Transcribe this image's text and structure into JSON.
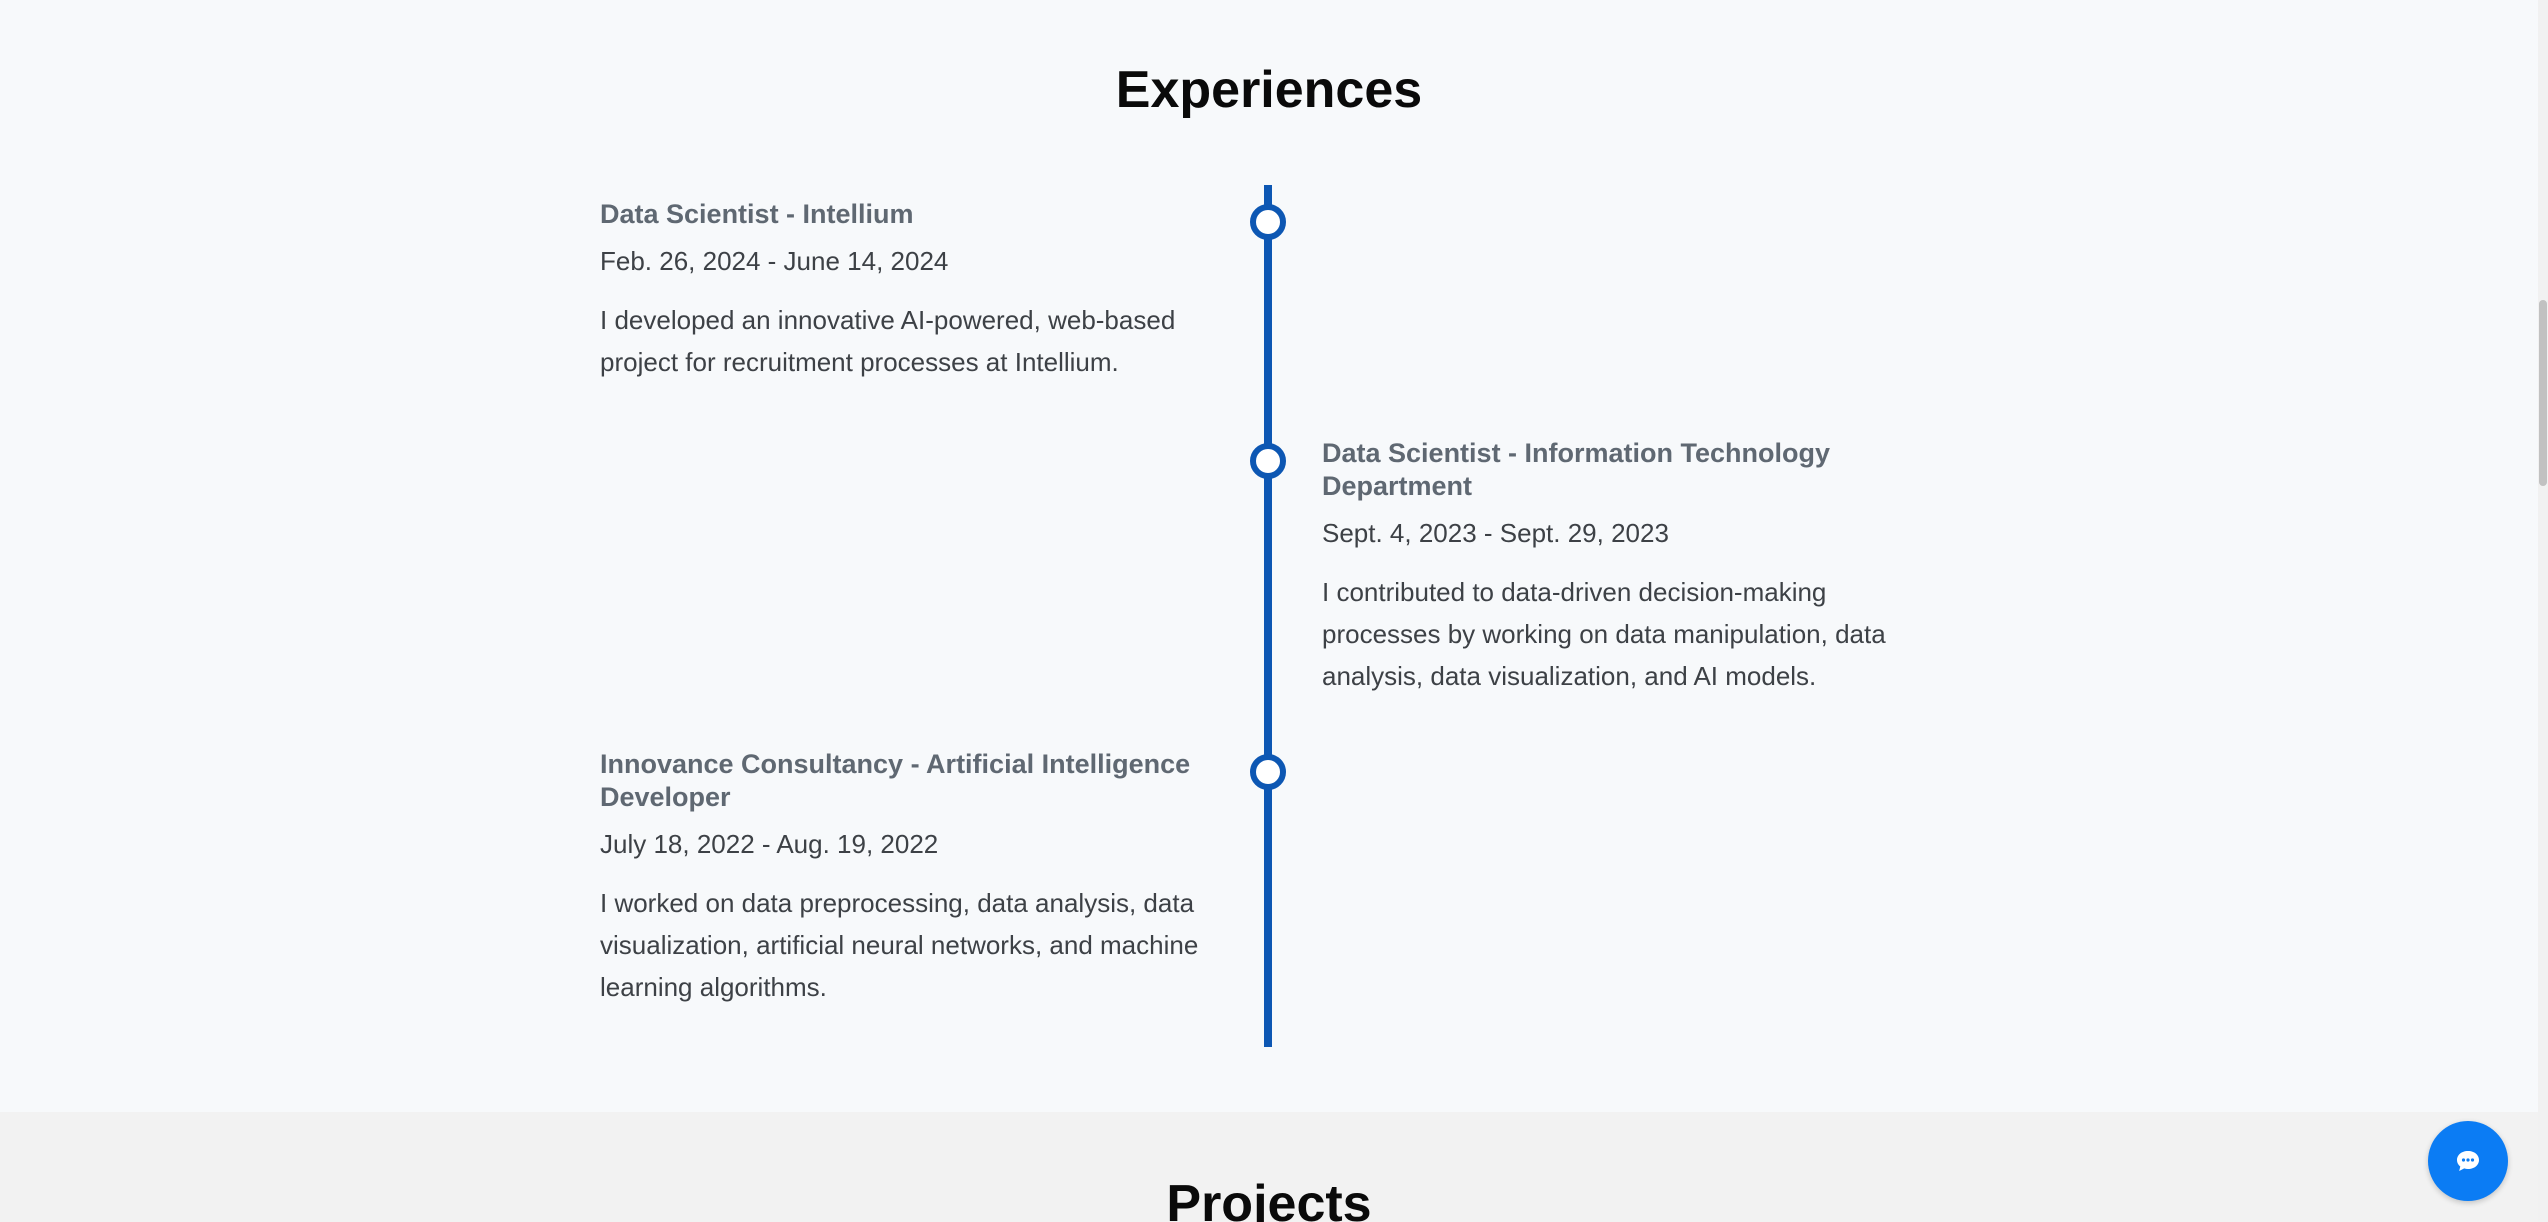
{
  "experiences": {
    "title": "Experiences",
    "items": [
      {
        "title": "Data Scientist - Intellium",
        "date": "Feb. 26, 2024 - June 14, 2024",
        "description": "I developed an innovative AI-powered, web-based project for recruitment processes at Intellium."
      },
      {
        "title": "Data Scientist - Information Technology Department",
        "date": "Sept. 4, 2023 - Sept. 29, 2023",
        "description": "I contributed to data-driven decision-making processes by working on data manipulation, data analysis, data visualization, and AI models."
      },
      {
        "title": "Innovance Consultancy - Artificial Intelligence Developer",
        "date": "July 18, 2022 - Aug. 19, 2022",
        "description": "I worked on data preprocessing, data analysis, data visualization, artificial neural networks, and machine learning algorithms."
      }
    ]
  },
  "projects": {
    "title": "Projects"
  },
  "chat_button": {
    "icon": "chat-bubble-icon"
  },
  "colors": {
    "timeline_accent": "#0d57b3",
    "chat_button": "#0b7cf4"
  }
}
